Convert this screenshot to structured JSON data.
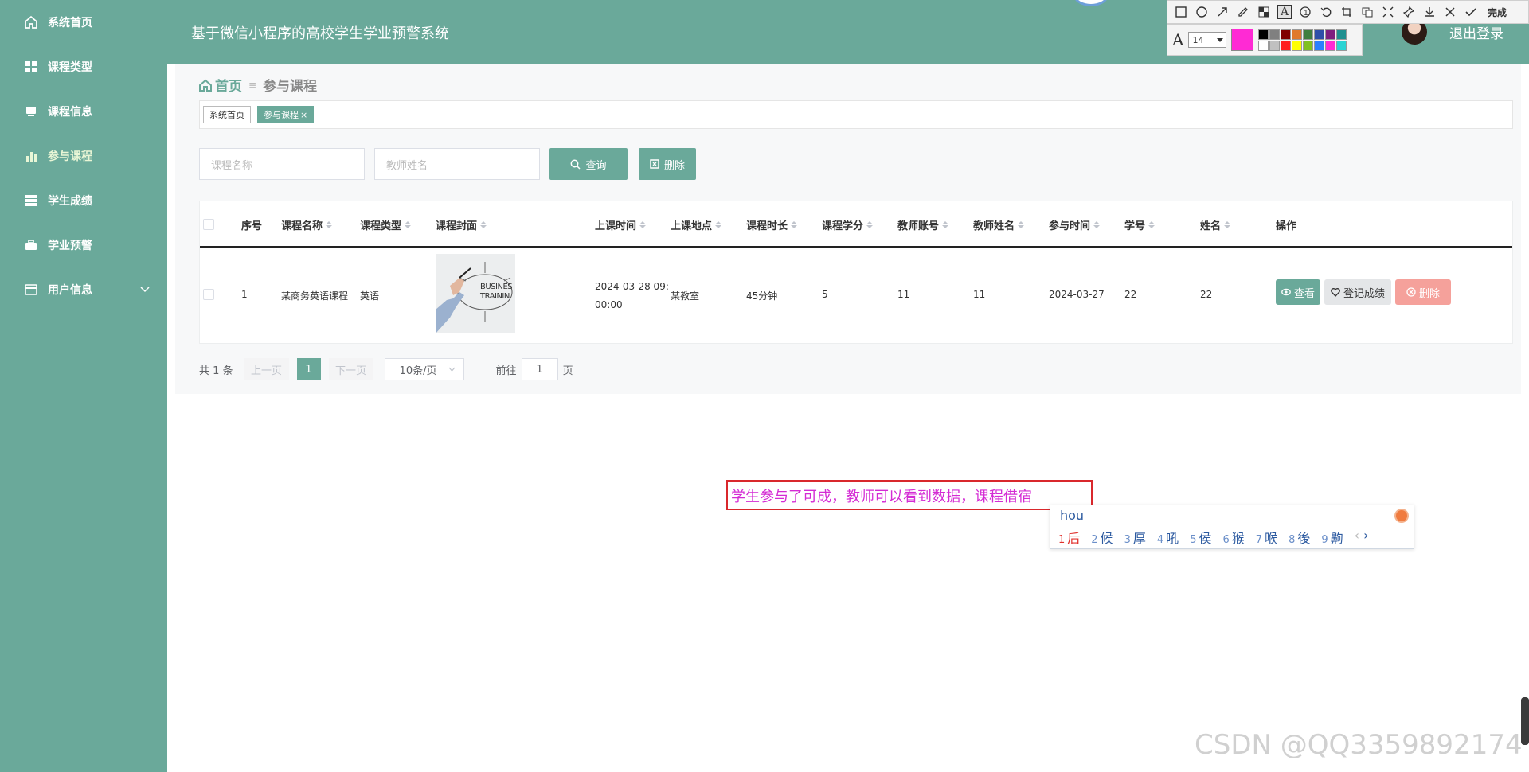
{
  "app": {
    "title": "基于微信小程序的高校学生学业预警系统",
    "logout": "退出登录"
  },
  "sidebar": {
    "items": [
      {
        "label": "系统首页",
        "icon": "home-icon"
      },
      {
        "label": "课程类型",
        "icon": "grid-icon"
      },
      {
        "label": "课程信息",
        "icon": "monitor-icon"
      },
      {
        "label": "参与课程",
        "icon": "bar-chart-icon"
      },
      {
        "label": "学生成绩",
        "icon": "table-icon"
      },
      {
        "label": "学业预警",
        "icon": "briefcase-icon"
      },
      {
        "label": "用户信息",
        "icon": "card-icon"
      }
    ]
  },
  "breadcrumb": {
    "home": "首页",
    "current": "参与课程"
  },
  "tags": [
    "系统首页",
    "参与课程"
  ],
  "search": {
    "course_placeholder": "课程名称",
    "teacher_placeholder": "教师姓名",
    "query": "查询",
    "delete": "删除"
  },
  "table": {
    "headers": [
      "序号",
      "课程名称",
      "课程类型",
      "课程封面",
      "上课时间",
      "上课地点",
      "课程时长",
      "课程学分",
      "教师账号",
      "教师姓名",
      "参与时间",
      "学号",
      "姓名",
      "操作"
    ],
    "rows": [
      {
        "index": "1",
        "course_name": "某商务英语课程",
        "course_type": "英语",
        "cover_text_1": "BUSINES",
        "cover_text_2": "TRAININ",
        "time_1": "2024-03-28 09:",
        "time_2": "00:00",
        "location": "某教室",
        "duration": "45分钟",
        "credit": "5",
        "teacher_account": "11",
        "teacher_name": "11",
        "join_time": "2024-03-27",
        "student_id": "22",
        "student_name": "22"
      }
    ],
    "actions": {
      "view": "查看",
      "record": "登记成绩",
      "delete": "删除"
    }
  },
  "pagination": {
    "total": "共 1 条",
    "prev": "上一页",
    "page": "1",
    "next": "下一页",
    "size": "10条/页",
    "goto_prefix": "前往",
    "goto_value": "1",
    "goto_suffix": "页"
  },
  "annotation_toolbar": {
    "done": "完成",
    "font_letter": "A",
    "font_size": "14",
    "current_color": "#ff2ad4",
    "palette": [
      "#000000",
      "#808080",
      "#800000",
      "#e07a2c",
      "#3f7f3f",
      "#2f4fa8",
      "#7f1f7f",
      "#1f8f8f",
      "#ffffff",
      "#c0c0c0",
      "#ff2020",
      "#ffff00",
      "#80c020",
      "#2a7fff",
      "#ff2ad4",
      "#2ad4d4"
    ]
  },
  "annotation": {
    "text": "学生参与了可成，教师可以看到数据，课程借宿"
  },
  "ime": {
    "pinyin": "hou",
    "candidates": [
      {
        "n": "1",
        "c": "后"
      },
      {
        "n": "2",
        "c": "候"
      },
      {
        "n": "3",
        "c": "厚"
      },
      {
        "n": "4",
        "c": "吼"
      },
      {
        "n": "5",
        "c": "侯"
      },
      {
        "n": "6",
        "c": "猴"
      },
      {
        "n": "7",
        "c": "喉"
      },
      {
        "n": "8",
        "c": "後"
      },
      {
        "n": "9",
        "c": "齁"
      }
    ]
  },
  "watermark": "CSDN @QQ3359892174",
  "colors": {
    "brand": "#6aa99a",
    "danger_light": "#f5a19b",
    "annotation_red": "#d9282c",
    "annotation_magenta": "#d42bd4"
  }
}
